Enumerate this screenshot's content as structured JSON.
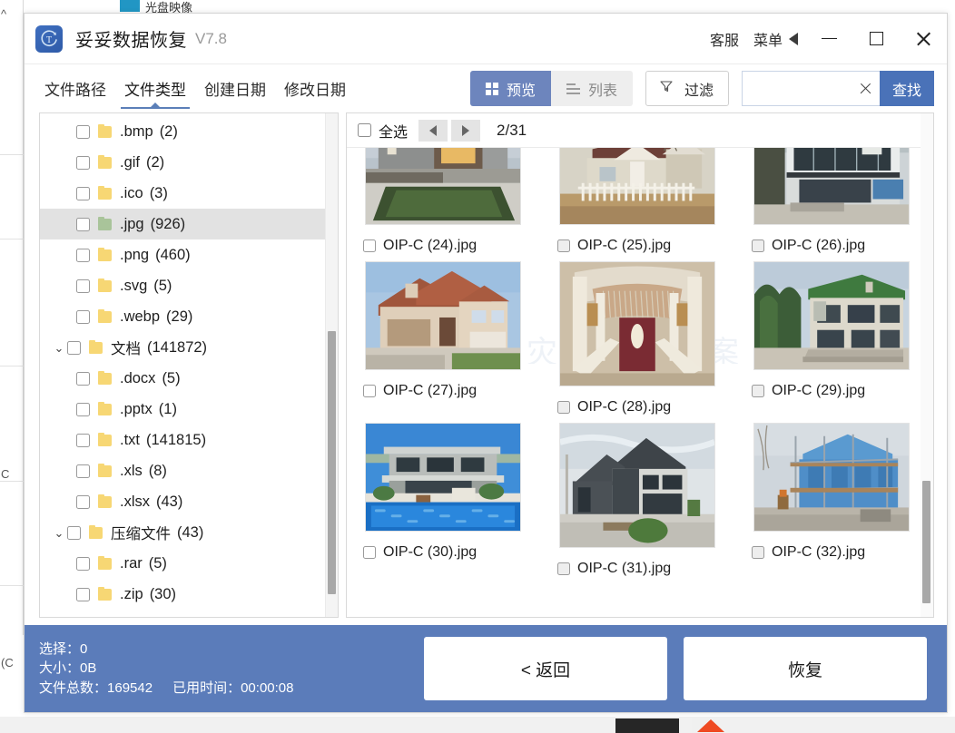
{
  "background": {
    "top_tab_text": "光盘映像",
    "left_edge_glyphs": [
      "^",
      "C",
      "(C"
    ]
  },
  "titlebar": {
    "logo_icon": "app-logo-icon",
    "app_name": "妥妥数据恢复",
    "version": "V7.8",
    "support_label": "客服",
    "menu_label": "菜单",
    "menu_caret_icon": "triangle-left-icon",
    "minimize_icon": "minimize-icon",
    "maximize_icon": "maximize-icon",
    "close_icon": "close-icon"
  },
  "tabs": [
    {
      "label": "文件路径",
      "active": false
    },
    {
      "label": "文件类型",
      "active": true
    },
    {
      "label": "创建日期",
      "active": false
    },
    {
      "label": "修改日期",
      "active": false
    }
  ],
  "toolbar": {
    "preview_label": "预览",
    "preview_icon": "grid-icon",
    "list_label": "列表",
    "list_icon": "list-icon",
    "filter_label": "过滤",
    "filter_icon": "funnel-icon",
    "search_value": "",
    "search_placeholder": "",
    "search_clear_icon": "clear-x-icon",
    "search_button_label": "查找"
  },
  "tree": [
    {
      "label": ".bmp",
      "count": "(2)",
      "indent": 1,
      "expander": "",
      "selected": false,
      "folder": "yellow"
    },
    {
      "label": ".gif",
      "count": "(2)",
      "indent": 1,
      "expander": "",
      "selected": false,
      "folder": "yellow"
    },
    {
      "label": ".ico",
      "count": "(3)",
      "indent": 1,
      "expander": "",
      "selected": false,
      "folder": "yellow"
    },
    {
      "label": ".jpg",
      "count": "(926)",
      "indent": 1,
      "expander": "",
      "selected": true,
      "folder": "green"
    },
    {
      "label": ".png",
      "count": "(460)",
      "indent": 1,
      "expander": "",
      "selected": false,
      "folder": "yellow"
    },
    {
      "label": ".svg",
      "count": "(5)",
      "indent": 1,
      "expander": "",
      "selected": false,
      "folder": "yellow"
    },
    {
      "label": ".webp",
      "count": "(29)",
      "indent": 1,
      "expander": "",
      "selected": false,
      "folder": "yellow"
    },
    {
      "label": "文档",
      "count": "(141872)",
      "indent": 0,
      "expander": "⌄",
      "selected": false,
      "folder": "yellow"
    },
    {
      "label": ".docx",
      "count": "(5)",
      "indent": 1,
      "expander": "",
      "selected": false,
      "folder": "yellow"
    },
    {
      "label": ".pptx",
      "count": "(1)",
      "indent": 1,
      "expander": "",
      "selected": false,
      "folder": "yellow"
    },
    {
      "label": ".txt",
      "count": "(141815)",
      "indent": 1,
      "expander": "",
      "selected": false,
      "folder": "yellow"
    },
    {
      "label": ".xls",
      "count": "(8)",
      "indent": 1,
      "expander": "",
      "selected": false,
      "folder": "yellow"
    },
    {
      "label": ".xlsx",
      "count": "(43)",
      "indent": 1,
      "expander": "",
      "selected": false,
      "folder": "yellow"
    },
    {
      "label": "压缩文件",
      "count": "(43)",
      "indent": 0,
      "expander": "⌄",
      "selected": false,
      "folder": "yellow"
    },
    {
      "label": ".rar",
      "count": "(5)",
      "indent": 1,
      "expander": "",
      "selected": false,
      "folder": "yellow"
    },
    {
      "label": ".zip",
      "count": "(30)",
      "indent": 1,
      "expander": "",
      "selected": false,
      "folder": "yellow"
    }
  ],
  "preview": {
    "select_all_label": "全选",
    "prev_icon": "triangle-left-icon",
    "next_icon": "triangle-right-icon",
    "page_text": "2/31",
    "watermark": "灾恢复方案",
    "items": [
      {
        "name": "OIP-C (24).jpg",
        "kind": "modern-house-lawn",
        "checkbox": "white"
      },
      {
        "name": "OIP-C (25).jpg",
        "kind": "white-cottage-fence",
        "checkbox": "gray"
      },
      {
        "name": "OIP-C (26).jpg",
        "kind": "glass-modern-house",
        "checkbox": "gray"
      },
      {
        "name": "OIP-C (27).jpg",
        "kind": "stucco-suburban-home",
        "checkbox": "white"
      },
      {
        "name": "OIP-C (28).jpg",
        "kind": "victorian-porch",
        "checkbox": "gray"
      },
      {
        "name": "OIP-C (29).jpg",
        "kind": "green-roof-house",
        "checkbox": "gray"
      },
      {
        "name": "OIP-C (30).jpg",
        "kind": "pool-villa",
        "checkbox": "white"
      },
      {
        "name": "OIP-C (31).jpg",
        "kind": "dark-gable-house",
        "checkbox": "gray"
      },
      {
        "name": "OIP-C (32).jpg",
        "kind": "scaffold-construction",
        "checkbox": "gray"
      }
    ]
  },
  "footer": {
    "selected_label": "选择：",
    "selected_value": "0",
    "size_label": "大小：",
    "size_value": "0B",
    "total_label": "文件总数：",
    "total_value": "169542",
    "elapsed_label": "已用时间：",
    "elapsed_value": "00:00:08",
    "back_label": "< 返回",
    "recover_label": "恢复"
  },
  "colors": {
    "accent_blue": "#5b7cba",
    "toggle_on": "#6d85bd",
    "search_button": "#4a72b8",
    "folder_yellow": "#f7d774",
    "folder_green": "#a9c49a",
    "selected_row": "#e2e2e2"
  }
}
